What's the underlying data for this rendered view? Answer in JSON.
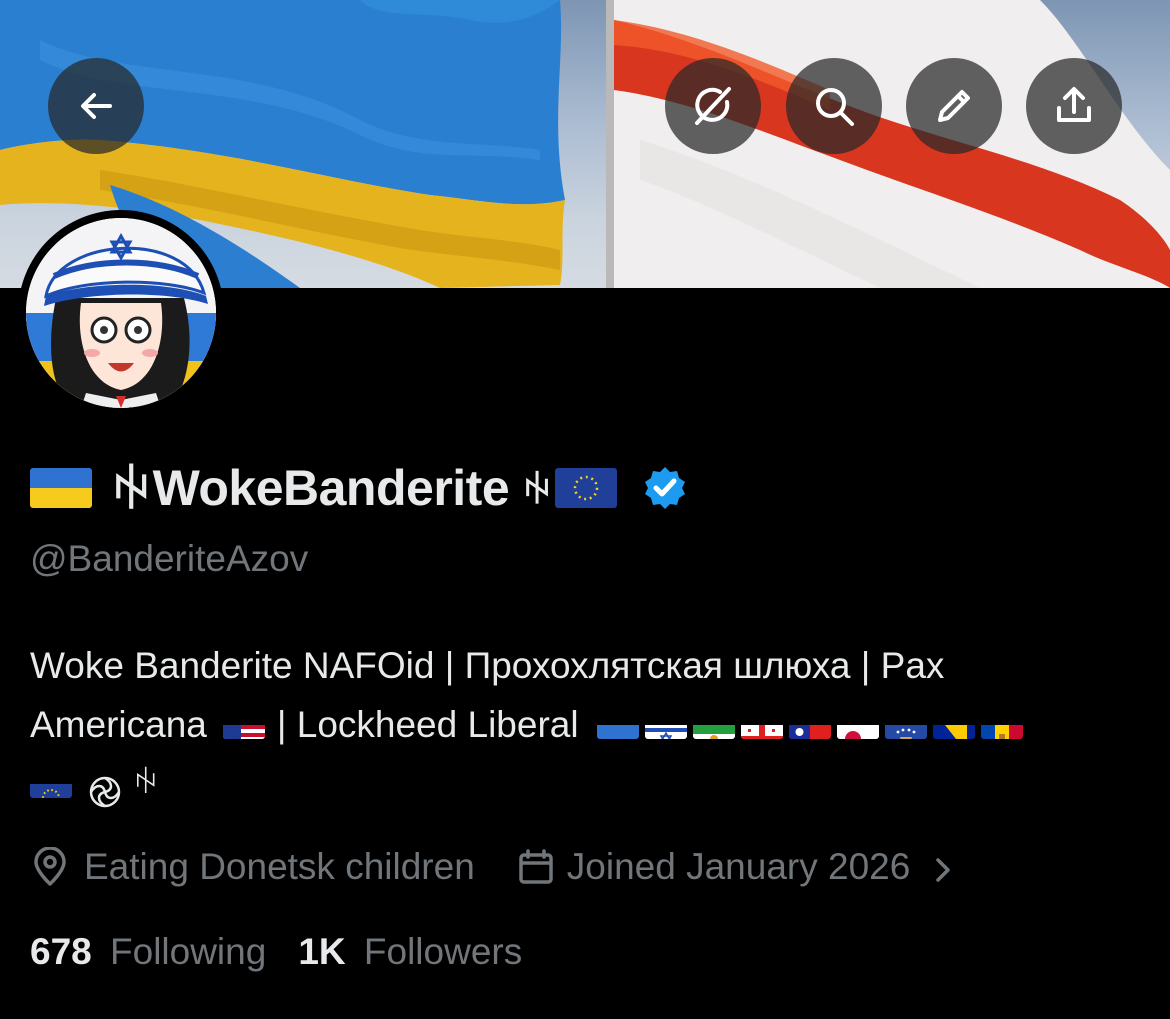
{
  "header": {
    "back_icon": "arrow-left-icon",
    "actions": [
      "grok-icon",
      "search-icon",
      "edit-icon",
      "share-icon"
    ]
  },
  "profile": {
    "display_name": "WokeBanderite",
    "name_prefix_flag": "ukraine-flag",
    "name_glyph": "ꑭ",
    "name_suffix_flag": "eu-flag",
    "verified": true,
    "verified_color": "#1d9bf0",
    "handle": "@BanderiteAzov"
  },
  "bio": {
    "line1": "Woke Banderite NAFOid | Прохохлятская шлюха | Pax",
    "line2_text": "Americana",
    "line2_sep": "| Lockheed Liberal",
    "line3_glyph": "ꑭ",
    "flags": [
      "ukraine",
      "israel",
      "iran-lion-sun",
      "georgia",
      "taiwan",
      "greenland",
      "kosovo",
      "bosnia",
      "moldova",
      "eu"
    ]
  },
  "meta": {
    "location_icon": "location-pin-icon",
    "location": "Eating Donetsk children",
    "calendar_icon": "calendar-icon",
    "joined": "Joined January 2026",
    "chevron_icon": "chevron-right-icon"
  },
  "stats": {
    "following_count": "678",
    "following_label": "Following",
    "followers_count": "1K",
    "followers_label": "Followers"
  },
  "colors": {
    "background": "#000000",
    "primary_text": "#e7e9ea",
    "secondary_text": "#71767b",
    "accent": "#1d9bf0"
  }
}
